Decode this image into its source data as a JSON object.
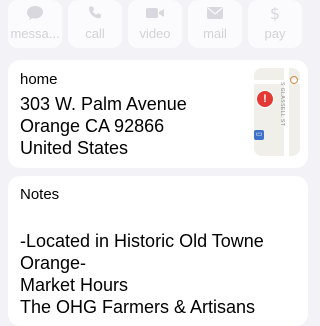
{
  "actions": [
    {
      "icon": "message-icon",
      "label": "messa..."
    },
    {
      "icon": "phone-icon",
      "label": "call"
    },
    {
      "icon": "video-icon",
      "label": "video"
    },
    {
      "icon": "mail-icon",
      "label": "mail"
    },
    {
      "icon": "dollar-icon",
      "label": "pay"
    }
  ],
  "address": {
    "label": "home",
    "line1": "303 W. Palm Avenue",
    "line2": "Orange CA 92866",
    "line3": "United States"
  },
  "map": {
    "street_label": "S GLASSELL ST"
  },
  "notes": {
    "label": "Notes",
    "lines": [
      "-Located in Historic Old Towne",
      "Orange-",
      "Market Hours",
      "The OHG Farmers & Artisans"
    ]
  },
  "colors": {
    "background": "#f2f2f7",
    "card": "#ffffff",
    "muted_text": "#d2d2d8",
    "pin_red": "#e53935",
    "transit_blue": "#3f73c9"
  }
}
